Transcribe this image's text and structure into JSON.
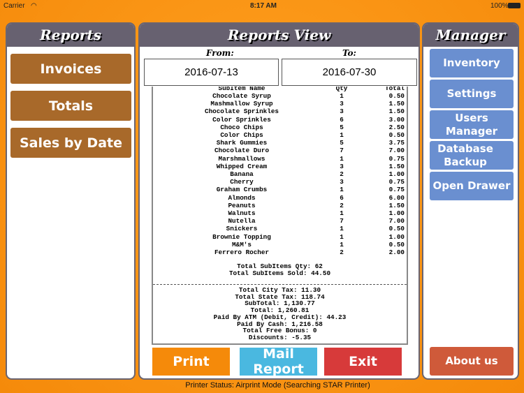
{
  "status_bar": {
    "carrier": "Carrier",
    "time": "8:17 AM",
    "battery": "100%"
  },
  "left": {
    "title": "Reports",
    "buttons": [
      "Invoices",
      "Totals",
      "Sales by Date"
    ]
  },
  "center": {
    "title": "Reports View",
    "from_label": "From:",
    "to_label": "To:",
    "from_date": "2016-07-13",
    "to_date": "2016-07-30",
    "columns": [
      "SubItem Name",
      "Qty",
      "Total"
    ],
    "items": [
      [
        "Chocolate Syrup",
        "1",
        "0.50"
      ],
      [
        "Mashmallow Syrup",
        "3",
        "1.50"
      ],
      [
        "Chocolate Sprinkles",
        "3",
        "1.50"
      ],
      [
        "Color Sprinkles",
        "6",
        "3.00"
      ],
      [
        "Choco Chips",
        "5",
        "2.50"
      ],
      [
        "Color Chips",
        "1",
        "0.50"
      ],
      [
        "Shark Gummies",
        "5",
        "3.75"
      ],
      [
        "Chocolate Duro",
        "7",
        "7.00"
      ],
      [
        "Marshmallows",
        "1",
        "0.75"
      ],
      [
        "Whipped Cream",
        "3",
        "1.50"
      ],
      [
        "Banana",
        "2",
        "1.00"
      ],
      [
        "Cherry",
        "3",
        "0.75"
      ],
      [
        "Graham Crumbs",
        "1",
        "0.75"
      ],
      [
        "Almonds",
        "6",
        "6.00"
      ],
      [
        "Peanuts",
        "2",
        "1.50"
      ],
      [
        "Walnuts",
        "1",
        "1.00"
      ],
      [
        "Nutella",
        "7",
        "7.00"
      ],
      [
        "Snickers",
        "1",
        "0.50"
      ],
      [
        "Brownie Topping",
        "1",
        "1.00"
      ],
      [
        "M&M's",
        "1",
        "0.50"
      ],
      [
        "Ferrero Rocher",
        "2",
        "2.00"
      ]
    ],
    "subtotals": [
      "Total SubItems Qty: 62",
      "Total SubItems Sold: 44.50"
    ],
    "totals": [
      "Total City Tax: 11.30",
      "Total State Tax: 118.74",
      "SubTotal: 1,130.77",
      "Total: 1,260.81",
      "Paid By ATM (Debit, Credit): 44.23",
      "Paid By Cash: 1,216.58",
      "Total Free Bonus: 0",
      "Discounts: -5.35"
    ],
    "print": "Print",
    "mail": "Mail Report",
    "exit": "Exit"
  },
  "right": {
    "title": "Manager",
    "buttons": [
      "Inventory",
      "Settings",
      "Users Manager",
      "Database Backup",
      "Open Drawer"
    ],
    "about": "About us"
  },
  "printer_status": "Printer Status: Airprint Mode (Searching STAR Printer)"
}
